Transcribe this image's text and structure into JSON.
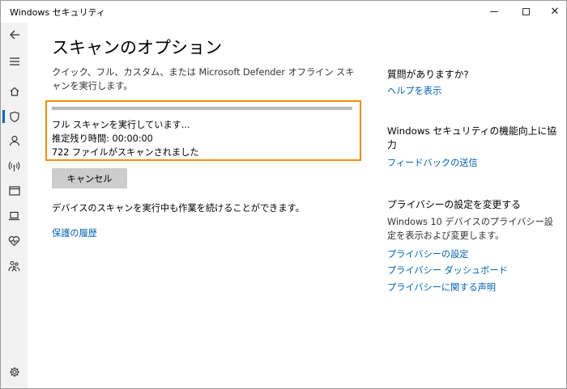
{
  "window": {
    "title": "Windows セキュリティ",
    "controls": {
      "minimize": "minimize",
      "maximize": "maximize",
      "close": "✕"
    }
  },
  "sidebar": {
    "items": [
      {
        "name": "back",
        "icon": "back-arrow-icon"
      },
      {
        "name": "menu",
        "icon": "hamburger-icon"
      },
      {
        "name": "home",
        "icon": "home-icon"
      },
      {
        "name": "virus-protection",
        "icon": "shield-icon",
        "active": true
      },
      {
        "name": "account",
        "icon": "person-icon"
      },
      {
        "name": "firewall",
        "icon": "wifi-icon"
      },
      {
        "name": "app-browser",
        "icon": "app-window-icon"
      },
      {
        "name": "device-security",
        "icon": "laptop-icon"
      },
      {
        "name": "device-health",
        "icon": "heart-icon"
      },
      {
        "name": "family",
        "icon": "family-icon"
      },
      {
        "name": "settings",
        "icon": "gear-icon"
      }
    ]
  },
  "main": {
    "title": "スキャンのオプション",
    "description": "クイック、フル、カスタム、または Microsoft Defender オフライン スキャンを実行します。",
    "scan": {
      "progress_fraction": 1.0,
      "status": "フル スキャンを実行しています...",
      "remaining": "推定残り時間: 00:00:00",
      "files": "722 ファイルがスキャンされました"
    },
    "cancel_label": "キャンセル",
    "background_note": "デバイスのスキャンを実行中も作業を続けることができます。",
    "history_link": "保護の履歴"
  },
  "right": {
    "question_heading": "質問がありますか?",
    "help_link": "ヘルプを表示",
    "feedback_heading": "Windows セキュリティの機能向上に協力",
    "feedback_link": "フィードバックの送信",
    "privacy_heading": "プライバシーの設定を変更する",
    "privacy_text": "Windows 10 デバイスのプライバシー設定を表示および変更します。",
    "privacy_links": [
      "プライバシーの設定",
      "プライバシー ダッシュボード",
      "プライバシーに関する声明"
    ]
  },
  "colors": {
    "accent": "#0063b1",
    "highlight": "#f28c0f",
    "sidebar_bg": "#f2f2f2"
  }
}
